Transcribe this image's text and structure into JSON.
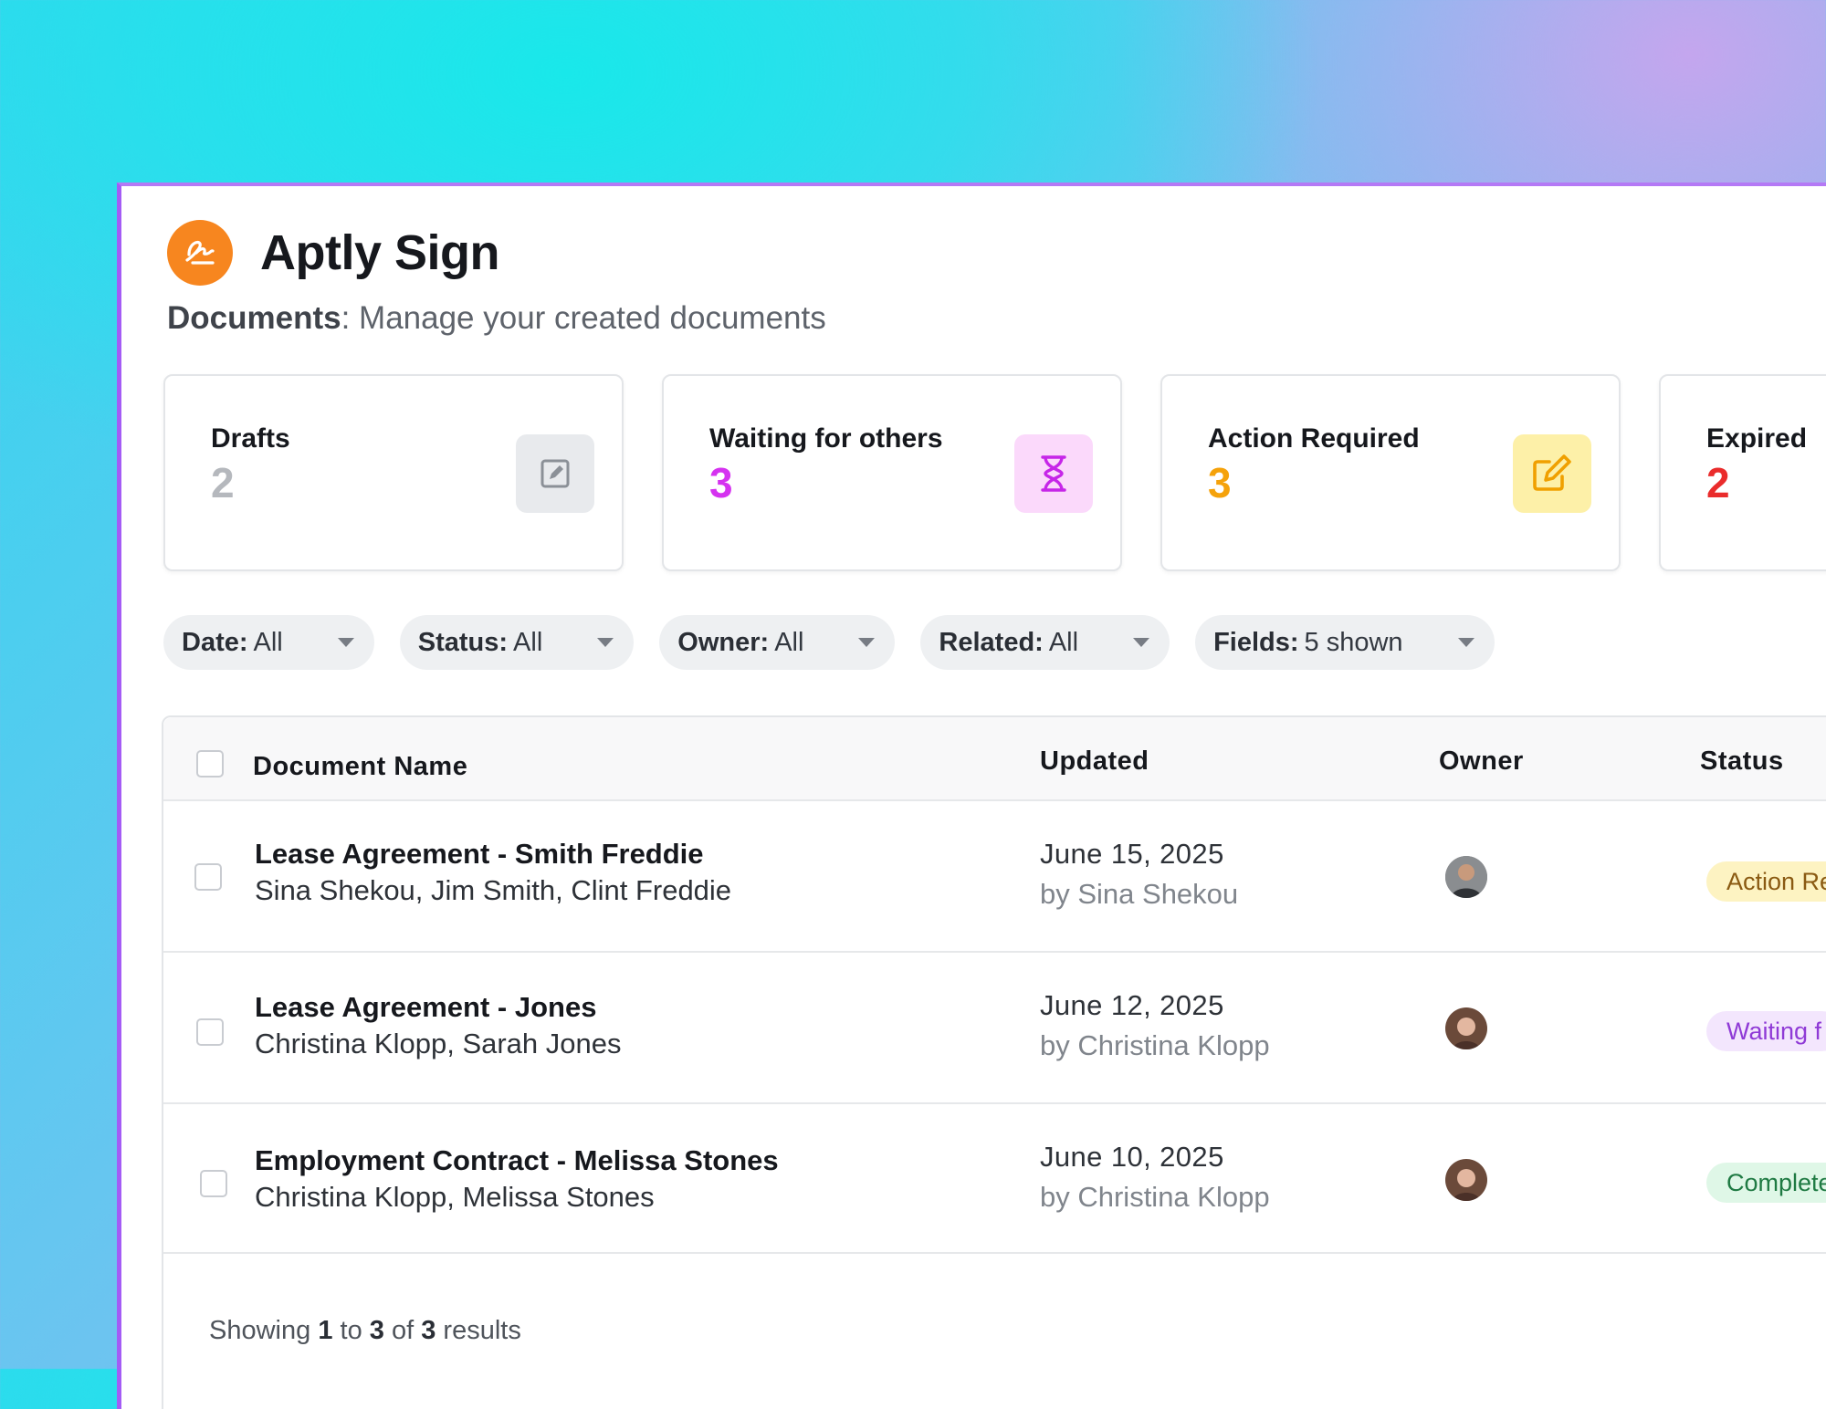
{
  "app": {
    "title": "Aptly Sign",
    "subtitle_section": "Documents",
    "subtitle_text": ": Manage your created documents"
  },
  "cards": [
    {
      "label": "Drafts",
      "count": "2",
      "count_color": "#b5b8bd",
      "icon": "edit-square-icon",
      "icon_bg": "#e8eaed"
    },
    {
      "label": "Waiting for others",
      "count": "3",
      "count_color": "#d532f0",
      "icon": "hourglass-icon",
      "icon_bg": "#fbd9fb"
    },
    {
      "label": "Action Required",
      "count": "3",
      "count_color": "#f5a20b",
      "icon": "pen-square-icon",
      "icon_bg": "#fdf0a8"
    },
    {
      "label": "Expired",
      "count": "2",
      "count_color": "#ea2c2c"
    }
  ],
  "filters": [
    {
      "label": "Date:",
      "value": "All"
    },
    {
      "label": "Status:",
      "value": "All"
    },
    {
      "label": "Owner:",
      "value": "All"
    },
    {
      "label": "Related:",
      "value": "All"
    },
    {
      "label": "Fields:",
      "value": "5 shown"
    }
  ],
  "table": {
    "columns": [
      "Document Name",
      "Updated",
      "Owner",
      "Status"
    ],
    "rows": [
      {
        "name": "Lease Agreement - Smith Freddie",
        "people": "Sina Shekou, Jim Smith, Clint Freddie",
        "date": "June 15, 2025",
        "by": "by Sina Shekou",
        "status": "Action Re",
        "status_bg": "#fdf3c2",
        "status_color": "#8a5a12"
      },
      {
        "name": "Lease Agreement - Jones",
        "people": "Christina Klopp, Sarah Jones",
        "date": "June 12, 2025",
        "by": "by Christina Klopp",
        "status": "Waiting f",
        "status_bg": "#f3e6fd",
        "status_color": "#8f3ad6"
      },
      {
        "name": "Employment Contract - Melissa Stones",
        "people": "Christina Klopp, Melissa Stones",
        "date": "June 10, 2025",
        "by": "by Christina Klopp",
        "status": "Complete",
        "status_bg": "#dff7e7",
        "status_color": "#1f7a43"
      }
    ],
    "footer": {
      "prefix": "Showing ",
      "from": "1",
      "to_word": " to ",
      "to": "3",
      "of_word": " of ",
      "total": "3",
      "suffix": " results"
    }
  }
}
